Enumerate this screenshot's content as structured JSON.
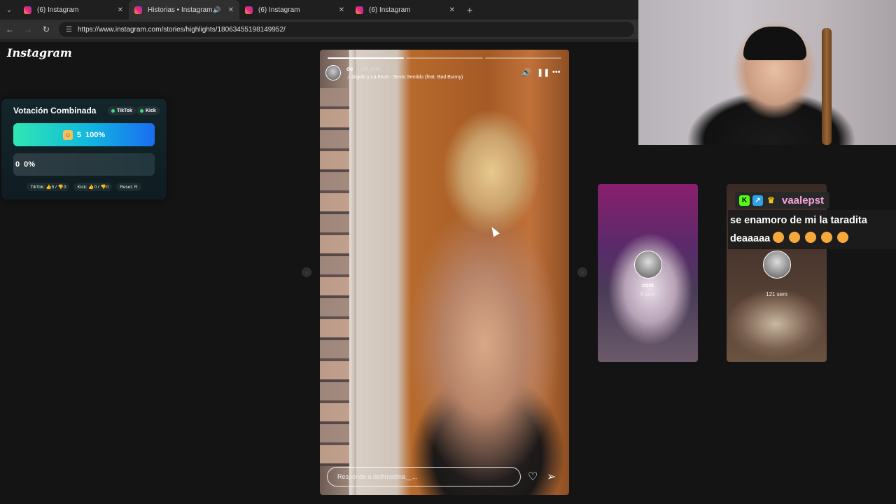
{
  "browser": {
    "tabs": [
      {
        "label": "(6) Instagram",
        "active": false
      },
      {
        "label": "Historias • Instagram",
        "active": true,
        "audio": true
      },
      {
        "label": "(6) Instagram",
        "active": false
      },
      {
        "label": "(6) Instagram",
        "active": false
      }
    ],
    "url": "https://www.instagram.com/stories/highlights/18063455198149952/"
  },
  "instagram": {
    "logo": "Instagram"
  },
  "poll": {
    "title": "Votación Combinada",
    "tag_tiktok": "TikTok",
    "tag_kick": "Kick",
    "option1": {
      "count": "5",
      "percent": "100%"
    },
    "option2": {
      "count": "0",
      "percent": "0%"
    },
    "footer": {
      "tiktok": "TikTok: 👍5 / 👎0",
      "kick": "Kick: 👍0 / 👎0",
      "reset": "Reset:"
    },
    "reset_key": "R"
  },
  "story": {
    "user": "de",
    "time": "64 sem",
    "song": "Gigolo y La Exce · Sexto Sentido (feat. Bad Bunny)",
    "reply_placeholder": "Responde a delfimedina__...",
    "progress_segments": 3,
    "progress_done": 1
  },
  "previews": [
    {
      "name": "cont",
      "time": "8 sem"
    },
    {
      "name": "",
      "time": "121 sem"
    }
  ],
  "chat": {
    "username": "vaalepst",
    "message": "se enamoro de mi la taradita deaaaaa",
    "username_color": "#f3a6d9"
  },
  "icons": {
    "tab_menu": "chevron-down-icon",
    "back": "arrow-left-icon",
    "forward": "arrow-right-icon",
    "reload": "reload-icon",
    "site_settings": "tune-icon",
    "mute": "speaker-icon",
    "pause": "pause-icon",
    "more": "more-icon",
    "like": "heart-icon",
    "share": "send-icon"
  }
}
